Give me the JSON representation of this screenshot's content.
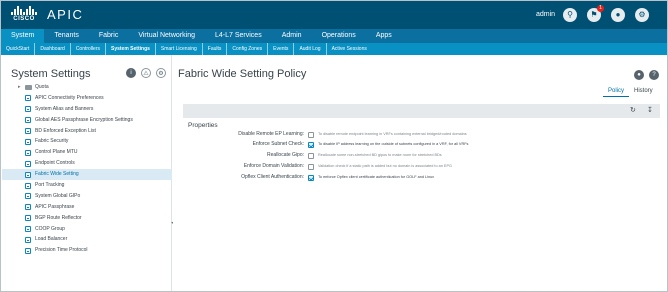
{
  "app": {
    "logo_text": "CISCO",
    "title": "APIC",
    "user": "admin",
    "notification_count": "1"
  },
  "icons": {
    "search": "search-icon",
    "notifications": "bell-icon",
    "user": "user-icon",
    "settings": "gear-icon",
    "info": "info-icon",
    "alert": "alert-icon",
    "pin": "pin-icon",
    "refresh": "refresh-icon",
    "download": "download-icon",
    "help": "help-icon",
    "folder": "folder-icon",
    "item": "item-icon"
  },
  "colors": {
    "topbar": "#005073",
    "mainnav": "#0b6fa0",
    "subnav": "#0991c4",
    "selected_row": "#daeaf4",
    "accent": "#0070a8"
  },
  "main_nav": {
    "tabs": [
      "System",
      "Tenants",
      "Fabric",
      "Virtual Networking",
      "L4-L7 Services",
      "Admin",
      "Operations",
      "Apps"
    ],
    "active": "System"
  },
  "sub_nav": {
    "tabs": [
      "QuickStart",
      "Dashboard",
      "Controllers",
      "System Settings",
      "Smart Licensing",
      "Faults",
      "Config Zones",
      "Events",
      "Audit Log",
      "Active Sessions"
    ],
    "active": "System Settings"
  },
  "left_panel": {
    "title": "System Settings",
    "items": [
      {
        "label": "Quota",
        "type": "folder"
      },
      {
        "label": "APIC Connectivity Preferences",
        "type": "item"
      },
      {
        "label": "System Alias and Banners",
        "type": "item"
      },
      {
        "label": "Global AES Passphrase Encryption Settings",
        "type": "item"
      },
      {
        "label": "BD Enforced Exception List",
        "type": "item"
      },
      {
        "label": "Fabric Security",
        "type": "item"
      },
      {
        "label": "Control Plane MTU",
        "type": "item"
      },
      {
        "label": "Endpoint Controls",
        "type": "item"
      },
      {
        "label": "Fabric Wide Setting",
        "type": "item",
        "selected": true
      },
      {
        "label": "Port Tracking",
        "type": "item"
      },
      {
        "label": "System Global GIPo",
        "type": "item"
      },
      {
        "label": "APIC Passphrase",
        "type": "item"
      },
      {
        "label": "BGP Route Reflector",
        "type": "item"
      },
      {
        "label": "COOP Group",
        "type": "item"
      },
      {
        "label": "Load Balancer",
        "type": "item"
      },
      {
        "label": "Precision Time Protocol",
        "type": "item"
      }
    ]
  },
  "main": {
    "title": "Fabric Wide Setting Policy",
    "tabs": [
      "Policy",
      "History"
    ],
    "active_tab": "Policy",
    "section": "Properties",
    "fields": [
      {
        "label": "Disable Remote EP Learning:",
        "checked": false,
        "description": "To disable remote endpoint learning in VRFs containing external bridged/routed domains"
      },
      {
        "label": "Enforce Subnet Check:",
        "checked": true,
        "description": "To disable IP address learning on the outside of subnets configured in a VRF, for all VRFs"
      },
      {
        "label": "Reallocate Gipo:",
        "checked": false,
        "description": "Reallocate some non-stretched BD gipos to make room for stretched BDs"
      },
      {
        "label": "Enforce Domain Validation:",
        "checked": false,
        "description": "Validation check if a static path is added but no domain is associated to an EPG"
      },
      {
        "label": "Opflex Client Authentication:",
        "checked": true,
        "description": "To enforce Opflex client certificate authentication for GOLF and Linux"
      }
    ]
  }
}
